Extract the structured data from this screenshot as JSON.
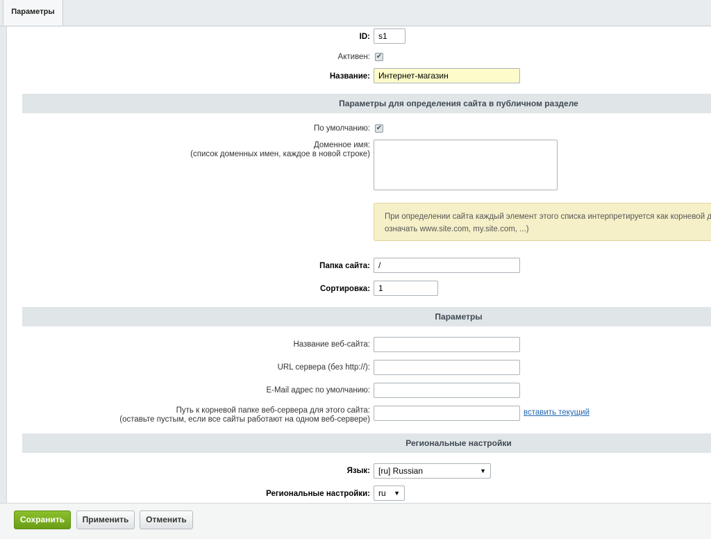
{
  "tabs": [
    {
      "label": "Параметры"
    }
  ],
  "main": {
    "id_label": "ID:",
    "id_value": "s1",
    "active_label": "Активен:",
    "active_checked": true,
    "name_label": "Название:",
    "name_value": "Интернет-магазин"
  },
  "public_section": {
    "title": "Параметры для определения сайта в публичном разделе",
    "default_label": "По умолчанию:",
    "default_checked": true,
    "domain_label": "Доменное имя:",
    "domain_hint": "(список доменных имен, каждое в новой строке)",
    "domain_value": "",
    "note_line1": "При определении сайта каждый элемент этого списка интерпретируется как корневой домен",
    "note_line2": "означать www.site.com, my.site.com, ...)",
    "folder_label": "Папка сайта:",
    "folder_value": "/",
    "sort_label": "Сортировка:",
    "sort_value": "1"
  },
  "params_section": {
    "title": "Параметры",
    "site_name_label": "Название веб-сайта:",
    "site_name_value": "",
    "server_url_label": "URL сервера (без http://):",
    "server_url_value": "",
    "email_label": "E-Mail адрес по умолчанию:",
    "email_value": "",
    "root_path_label": "Путь к корневой папке веб-сервера для этого сайта:",
    "root_path_hint": "(оставьте пустым, если все сайты работают на одном веб-сервере)",
    "root_path_value": "",
    "insert_current_link": "вставить текущий"
  },
  "regional_section": {
    "title": "Региональные настройки",
    "language_label": "Язык:",
    "language_value": "[ru] Russian",
    "regional_label": "Региональные настройки:",
    "regional_value": "ru"
  },
  "footer": {
    "save_label": "Сохранить",
    "apply_label": "Применить",
    "cancel_label": "Отменить"
  },
  "colors": {
    "save_button": "#78ad1c",
    "highlight_input": "#fdfbc9",
    "note_background": "#f6f0c9",
    "link": "#2067b0"
  }
}
